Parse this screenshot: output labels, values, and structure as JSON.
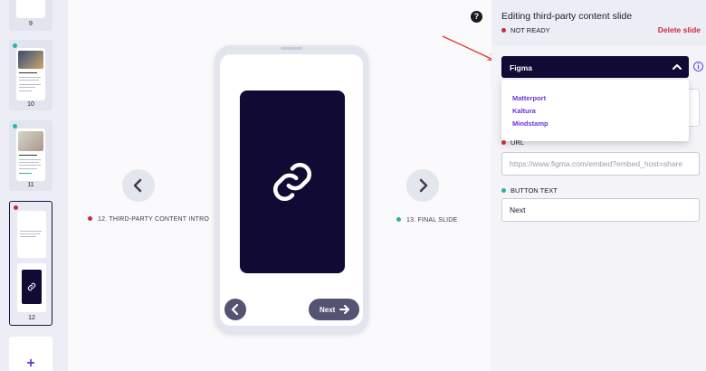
{
  "rail": {
    "slides": [
      {
        "number": "9"
      },
      {
        "number": "10",
        "status_color": "#2ab3a3",
        "mini_title": "Great point! 🎉"
      },
      {
        "number": "11",
        "status_color": "#2ab3a3",
        "mini_title": "Action Points 📝"
      },
      {
        "number": "12",
        "status_color": "#d4283c",
        "active": true
      }
    ],
    "add_label": "+"
  },
  "stage": {
    "help_icon": "?",
    "prev_slide_label": "12. THIRD-PARTY CONTENT INTRO",
    "prev_slide_color": "#d4283c",
    "next_slide_label": "13. FINAL SLIDE",
    "next_slide_color": "#2ab3a3",
    "phone": {
      "content_icon": "link-icon",
      "next_button_label": "Next"
    }
  },
  "panel": {
    "title": "Editing third-party content slide",
    "status": "NOT READY",
    "delete_label": "Delete slide",
    "provider_select": {
      "value": "Figma",
      "options": [
        "Matterport",
        "Kaltura",
        "Mindstamp"
      ]
    },
    "info_icon": "i",
    "url_field": {
      "label": "URL",
      "status_color": "#d4283c",
      "placeholder": "https://www.figma.com/embed?embed_host=share",
      "value": ""
    },
    "button_text_field": {
      "label": "BUTTON TEXT",
      "status_color": "#2ab3a3",
      "value": "Next"
    }
  },
  "colors": {
    "accent_dark": "#100a35",
    "accent_purple": "#6b35d8",
    "danger": "#d4283c",
    "ok": "#2ab3a3"
  }
}
